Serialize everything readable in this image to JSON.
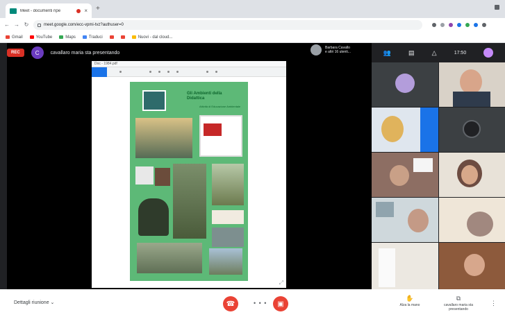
{
  "browser": {
    "tab_title": "Meet - documenti ripe",
    "tab_close": "×",
    "new_tab": "+",
    "url": "meet.google.com/ecc-vpmi-tvz?authuser=0",
    "nav": {
      "back": "←",
      "forward": "→",
      "reload": "↻"
    },
    "bookmarks": [
      {
        "label": "Gmail",
        "color": "#ea4335"
      },
      {
        "label": "YouTube",
        "color": "#ff0000"
      },
      {
        "label": "Maps",
        "color": "#34a853"
      },
      {
        "label": "Traduci",
        "color": "#4285f4"
      },
      {
        "label": "",
        "color": "#ea4335"
      },
      {
        "label": "",
        "color": "#ea4335"
      },
      {
        "label": "Nuovi - dal cloud...",
        "color": "#fbbc04"
      }
    ]
  },
  "meet": {
    "rec_label": "REC",
    "presenter_initial": "C",
    "presenting_text": "cavallaro maria sta presentando",
    "pinned_name": "Barbara Cavallo",
    "pinned_sub": "e altri 16 utenti...",
    "clock": "17:50",
    "document_title": "Doc - 1984.pdf"
  },
  "poster": {
    "title": "Gli Ambienti della Didattica",
    "subtitle": "Attività di Educazione Ambientale"
  },
  "bottom": {
    "details_label": "Dettagli riunione",
    "chevron": "⌄",
    "dots": "• • •",
    "raise_hand": "Alza la mano",
    "presenting_now": "cavallaro maria sta presentando",
    "more": "⋮"
  },
  "icons": {
    "end_call": "☎",
    "present": "▣",
    "people": "👥",
    "chat": "▤",
    "activities": "△",
    "hand": "✋",
    "screen": "⧉"
  }
}
